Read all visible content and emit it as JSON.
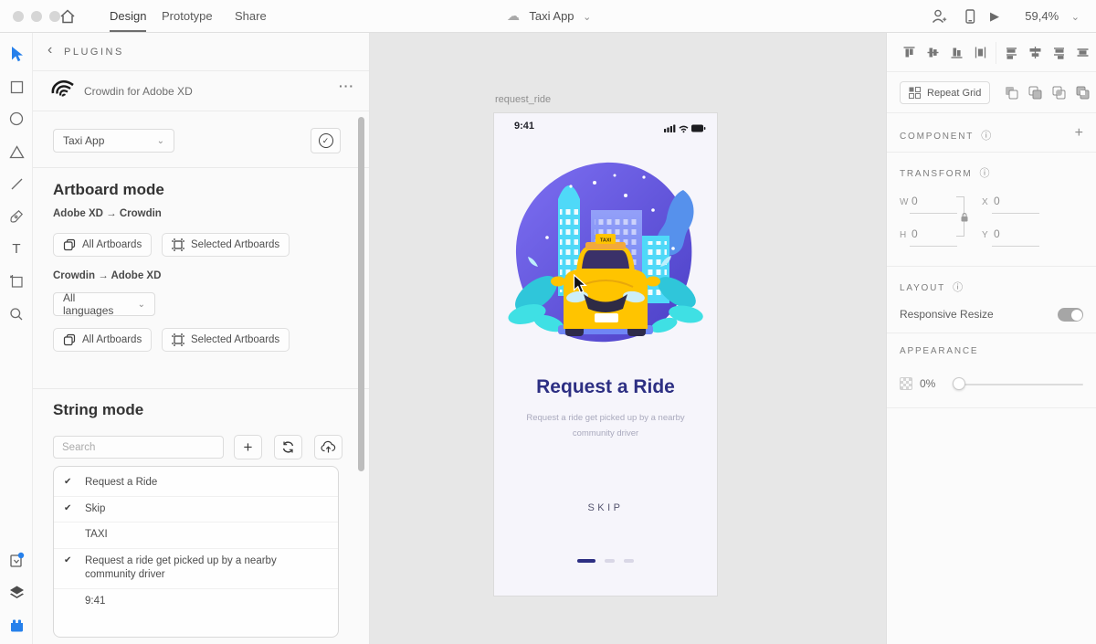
{
  "window": {
    "tabs": [
      "Design",
      "Prototype",
      "Share"
    ],
    "active_tab": "Design",
    "document_title": "Taxi App",
    "zoom_level": "59,4%"
  },
  "icons": {
    "back": "‹",
    "ellipsis": "···",
    "plus": "+",
    "check": "✔",
    "chevron_down": "⌄",
    "info": "ⓘ",
    "cloud": "☁",
    "play": "▶",
    "text_tool": "T"
  },
  "plugin_panel": {
    "header": "PLUGINS",
    "plugin_name": "Crowdin for Adobe XD",
    "project_select": {
      "value": "Taxi App"
    },
    "artboard_mode": {
      "title": "Artboard mode",
      "direction_1": "Adobe XD → Crowdin",
      "direction_2": "Crowdin → Adobe XD",
      "all_artboards_label": "All Artboards",
      "selected_artboards_label": "Selected Artboards",
      "languages_select": {
        "value": "All languages"
      }
    },
    "string_mode": {
      "title": "String mode",
      "search": {
        "placeholder": "Search"
      },
      "strings": [
        {
          "text": "Request a Ride",
          "checked": true
        },
        {
          "text": "Skip",
          "checked": true
        },
        {
          "text": "TAXI",
          "checked": false
        },
        {
          "text": "Request a ride get picked up by a nearby community driver",
          "checked": true
        },
        {
          "text": "9:41",
          "checked": false
        }
      ]
    }
  },
  "canvas": {
    "artboard_name": "request_ride",
    "screen": {
      "status_time": "9:41",
      "taxi_sign": "TAXI",
      "title": "Request a Ride",
      "subtitle": "Request a ride get picked up by a nearby community driver",
      "skip_label": "SKIP"
    }
  },
  "inspector": {
    "repeat_grid_label": "Repeat Grid",
    "component": {
      "title": "COMPONENT"
    },
    "transform": {
      "title": "TRANSFORM",
      "fields": [
        {
          "label": "W",
          "value": "0"
        },
        {
          "label": "X",
          "value": "0"
        },
        {
          "label": "H",
          "value": "0"
        },
        {
          "label": "Y",
          "value": "0"
        }
      ]
    },
    "layout": {
      "title": "LAYOUT",
      "responsive_resize_label": "Responsive Resize",
      "responsive_resize_on": true
    },
    "appearance": {
      "title": "APPEARANCE",
      "opacity": "0%"
    }
  },
  "colors": {
    "accent_blue": "#2680eb",
    "canvas_bg": "#e7e7e7",
    "title_indigo": "#2d2f83",
    "taxi_yellow": "#ffc400",
    "illustration_purple": "#6a5ae0",
    "illustration_cyan": "#4fd9f8"
  }
}
